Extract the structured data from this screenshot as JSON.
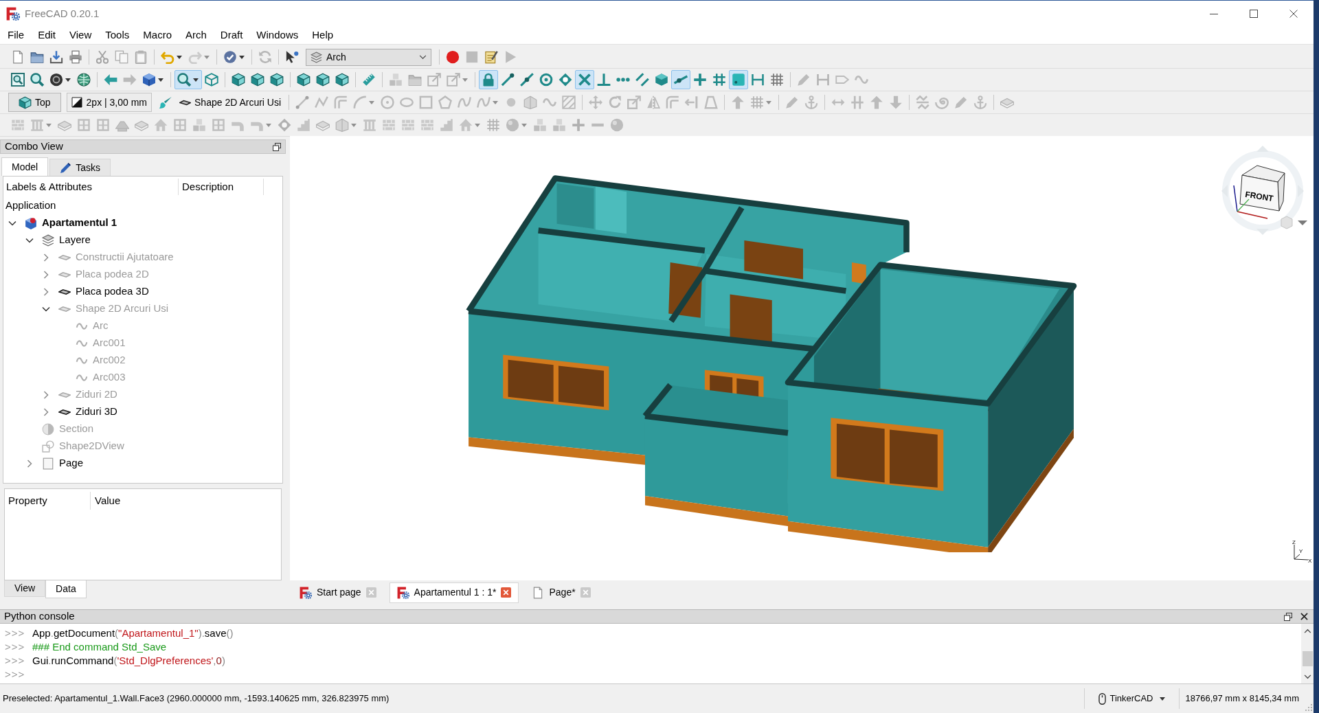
{
  "window": {
    "title": "FreeCAD 0.20.1"
  },
  "menu": [
    "File",
    "Edit",
    "View",
    "Tools",
    "Macro",
    "Arch",
    "Draft",
    "Windows",
    "Help"
  ],
  "toolbars": [
    {
      "workbench": "Arch",
      "buttons": [
        {
          "disabled": false
        },
        {
          "disabled": false
        },
        {
          "disabled": false
        },
        {
          "disabled": false
        },
        {
          "disabled": true
        },
        {
          "disabled": true
        },
        {
          "disabled": true
        },
        {
          "disabled": false
        },
        {
          "disabled": true
        },
        {
          "disabled": false
        },
        {
          "disabled": true
        },
        {
          "disabled": false
        },
        {
          "disabled": false
        },
        {
          "disabled": true
        },
        {
          "disabled": false
        },
        {
          "disabled": true
        }
      ]
    },
    {
      "buttons": [
        {
          "on": false,
          "disabled": false
        },
        {
          "on": false,
          "disabled": false
        },
        {
          "on": false,
          "disabled": false
        },
        {
          "on": false,
          "disabled": false
        },
        {
          "on": false,
          "disabled": false
        },
        {
          "on": false,
          "disabled": true
        },
        {
          "on": false,
          "disabled": false
        },
        {
          "on": true,
          "disabled": false
        },
        {
          "on": false,
          "disabled": false
        },
        {
          "on": false,
          "disabled": false
        },
        {
          "on": false,
          "disabled": false
        },
        {
          "on": false,
          "disabled": false
        },
        {
          "on": false,
          "disabled": false
        },
        {
          "on": false,
          "disabled": false
        },
        {
          "on": false,
          "disabled": false
        },
        {
          "on": false,
          "disabled": false
        },
        {
          "on": false,
          "disabled": true
        },
        {
          "on": false,
          "disabled": true
        },
        {
          "on": false,
          "disabled": true
        },
        {
          "on": false,
          "disabled": true
        },
        {
          "on": true,
          "disabled": false
        },
        {
          "on": false,
          "disabled": false
        },
        {
          "on": false,
          "disabled": false
        },
        {
          "on": false,
          "disabled": false
        },
        {
          "on": false,
          "disabled": false
        },
        {
          "on": true,
          "disabled": false
        },
        {
          "on": false,
          "disabled": false
        },
        {
          "on": false,
          "disabled": false
        },
        {
          "on": false,
          "disabled": false
        },
        {
          "on": false,
          "disabled": false
        },
        {
          "on": true,
          "disabled": false
        },
        {
          "on": false,
          "disabled": false
        },
        {
          "on": false,
          "disabled": false
        },
        {
          "on": true,
          "disabled": false
        },
        {
          "on": false,
          "disabled": false
        },
        {
          "on": false,
          "disabled": false
        },
        {
          "on": false,
          "disabled": true
        },
        {
          "on": false,
          "disabled": true
        },
        {
          "on": false,
          "disabled": true
        },
        {
          "on": false,
          "disabled": true
        }
      ]
    },
    {
      "working_plane": "Top",
      "style": "2px | 3,00 mm",
      "layer": "Shape 2D Arcuri Usi",
      "buttons": [
        {
          "disabled": false
        },
        {
          "disabled": true
        },
        {
          "disabled": true
        },
        {
          "disabled": true
        },
        {
          "disabled": true
        },
        {
          "disabled": true
        },
        {
          "disabled": true
        },
        {
          "disabled": true
        },
        {
          "disabled": true
        },
        {
          "disabled": true
        },
        {
          "disabled": true
        },
        {
          "disabled": true
        },
        {
          "disabled": true
        },
        {
          "disabled": true
        },
        {
          "disabled": true
        },
        {
          "disabled": true
        },
        {
          "disabled": true
        },
        {
          "disabled": true
        },
        {
          "disabled": true
        },
        {
          "disabled": true
        },
        {
          "disabled": true
        },
        {
          "disabled": true
        },
        {
          "disabled": true
        },
        {
          "disabled": true
        },
        {
          "disabled": true
        },
        {
          "disabled": true
        },
        {
          "disabled": true
        },
        {
          "disabled": true
        },
        {
          "disabled": true
        },
        {
          "disabled": true
        },
        {
          "disabled": true
        },
        {
          "disabled": true
        },
        {
          "disabled": true
        },
        {
          "disabled": true
        },
        {
          "disabled": true
        }
      ]
    },
    {
      "buttons": [
        {
          "disabled": true
        },
        {
          "disabled": true
        },
        {
          "disabled": true
        },
        {
          "disabled": true
        },
        {
          "disabled": true
        },
        {
          "disabled": true
        },
        {
          "disabled": true
        },
        {
          "disabled": true
        },
        {
          "disabled": true
        },
        {
          "disabled": true
        },
        {
          "disabled": true
        },
        {
          "disabled": true
        },
        {
          "disabled": true
        },
        {
          "disabled": true
        },
        {
          "disabled": true
        },
        {
          "disabled": true
        },
        {
          "disabled": true
        },
        {
          "disabled": true
        },
        {
          "disabled": true
        },
        {
          "disabled": true
        },
        {
          "disabled": true
        },
        {
          "disabled": true
        },
        {
          "disabled": true
        },
        {
          "disabled": true
        },
        {
          "disabled": true
        },
        {
          "disabled": true
        },
        {
          "disabled": true
        },
        {
          "disabled": true
        },
        {
          "disabled": true
        },
        {
          "disabled": true
        }
      ]
    }
  ],
  "combo_view": {
    "title": "Combo View",
    "tabs": [
      {
        "label": "Model",
        "selected": true
      },
      {
        "label": "Tasks",
        "selected": false
      }
    ],
    "tree": {
      "columns": [
        "Labels & Attributes",
        "Description"
      ],
      "root": "Application",
      "items": [
        {
          "label": "Apartamentul 1",
          "kind": "document",
          "expanded": true,
          "hidden": false,
          "children": [
            {
              "label": "Layere",
              "kind": "layers",
              "expanded": true,
              "hidden": false,
              "children": [
                {
                  "label": "Constructii Ajutatoare",
                  "kind": "layer",
                  "expanded": false,
                  "hidden": true
                },
                {
                  "label": "Placa podea 2D",
                  "kind": "layer",
                  "expanded": false,
                  "hidden": true
                },
                {
                  "label": "Placa podea 3D",
                  "kind": "layer",
                  "expanded": false,
                  "hidden": false
                },
                {
                  "label": "Shape 2D Arcuri Usi",
                  "kind": "layer",
                  "expanded": true,
                  "hidden": true,
                  "children": [
                    {
                      "label": "Arc",
                      "kind": "arc",
                      "hidden": true
                    },
                    {
                      "label": "Arc001",
                      "kind": "arc",
                      "hidden": true
                    },
                    {
                      "label": "Arc002",
                      "kind": "arc",
                      "hidden": true
                    },
                    {
                      "label": "Arc003",
                      "kind": "arc",
                      "hidden": true
                    }
                  ]
                },
                {
                  "label": "Ziduri 2D",
                  "kind": "layer",
                  "expanded": false,
                  "hidden": true
                },
                {
                  "label": "Ziduri 3D",
                  "kind": "layer",
                  "expanded": false,
                  "hidden": false
                }
              ]
            },
            {
              "label": "Section",
              "kind": "section",
              "hidden": true
            },
            {
              "label": "Shape2DView",
              "kind": "view",
              "hidden": true
            },
            {
              "label": "Page",
              "kind": "page",
              "expanded": false,
              "hidden": false
            }
          ]
        }
      ]
    },
    "properties": {
      "columns": [
        "Property",
        "Value"
      ],
      "tabs": [
        {
          "label": "View",
          "selected": false
        },
        {
          "label": "Data",
          "selected": true
        }
      ]
    }
  },
  "view_3d": {
    "nav_cube": {
      "face": "FRONT"
    },
    "axes": [
      "Z",
      "Y",
      "X"
    ]
  },
  "document_tabs": [
    {
      "label": "Start page",
      "kind": "start",
      "selected": false
    },
    {
      "label": "Apartamentul 1 : 1*",
      "kind": "document",
      "selected": true
    },
    {
      "label": "Page*",
      "kind": "page",
      "selected": false
    }
  ],
  "python_console": {
    "title": "Python console",
    "lines": [
      {
        "prompt": ">>>",
        "tokens": [
          {
            "kind": "name",
            "text": "App"
          },
          {
            "kind": "punct",
            "text": "."
          },
          {
            "kind": "name",
            "text": "getDocument"
          },
          {
            "kind": "punct",
            "text": "("
          },
          {
            "kind": "string",
            "text": "\"Apartamentul_1\""
          },
          {
            "kind": "punct",
            "text": ")."
          },
          {
            "kind": "name",
            "text": "save"
          },
          {
            "kind": "punct",
            "text": "()"
          }
        ]
      },
      {
        "prompt": ">>>",
        "tokens": [
          {
            "kind": "comment",
            "text": "### End command Std_Save"
          }
        ]
      },
      {
        "prompt": ">>>",
        "tokens": [
          {
            "kind": "name",
            "text": "Gui"
          },
          {
            "kind": "punct",
            "text": "."
          },
          {
            "kind": "name",
            "text": "runCommand"
          },
          {
            "kind": "punct",
            "text": "("
          },
          {
            "kind": "string",
            "text": "'Std_DlgPreferences'"
          },
          {
            "kind": "punct",
            "text": ","
          },
          {
            "kind": "number",
            "text": "0"
          },
          {
            "kind": "punct",
            "text": ")"
          }
        ]
      },
      {
        "prompt": ">>>"
      }
    ]
  },
  "status_bar": {
    "message": "Preselected: Apartamentul_1.Wall.Face3 (2960.000000 mm, -1593.140625 mm, 326.823975 mm)",
    "navigation": "TinkerCAD",
    "dimensions": "18766,97 mm x 8145,34 mm"
  }
}
